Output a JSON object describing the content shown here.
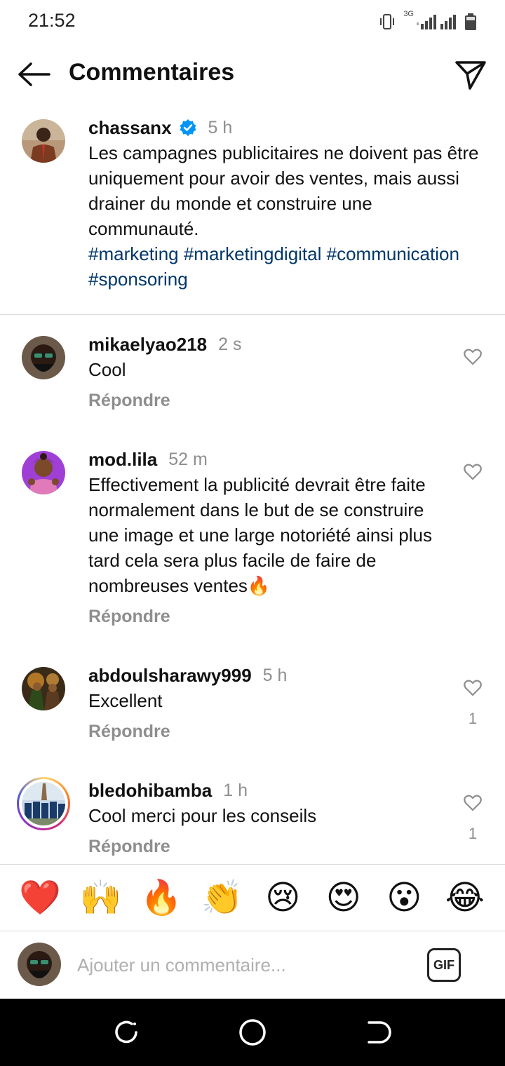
{
  "status_bar": {
    "time": "21:52",
    "network": "3G"
  },
  "header": {
    "title": "Commentaires"
  },
  "caption": {
    "username": "chassanx",
    "time": "5 h",
    "text": "Les campagnes publicitaires ne doivent pas être uniquement pour avoir des ventes, mais aussi drainer du monde et construire une communauté.",
    "hashtags": "#marketing #marketingdigital #communication #sponsoring"
  },
  "comments": [
    {
      "username": "mikaelyao218",
      "time": "2 s",
      "text": "Cool",
      "reply": "Répondre",
      "likes": ""
    },
    {
      "username": "mod.lila",
      "time": "52 m",
      "text": "Effectivement la publicité devrait être faite normalement dans le but de se construire une image et une large notoriété ainsi plus tard cela sera plus facile de faire de nombreuses ventes🔥",
      "reply": "Répondre",
      "likes": ""
    },
    {
      "username": "abdoulsharawy999",
      "time": "5 h",
      "text": "Excellent",
      "reply": "Répondre",
      "likes": "1"
    },
    {
      "username": "bledohibamba",
      "time": "1 h",
      "text": "Cool merci pour les conseils",
      "reply": "Répondre",
      "likes": "1"
    }
  ],
  "emoji_bar": [
    "❤️",
    "🙌",
    "🔥",
    "👏",
    "😢",
    "😍",
    "😮",
    "😂"
  ],
  "input": {
    "placeholder": "Ajouter un commentaire...",
    "gif_label": "GIF"
  },
  "colors": {
    "hashtag": "#00376b",
    "verified": "#0095f6",
    "muted": "#8e8e8e"
  }
}
